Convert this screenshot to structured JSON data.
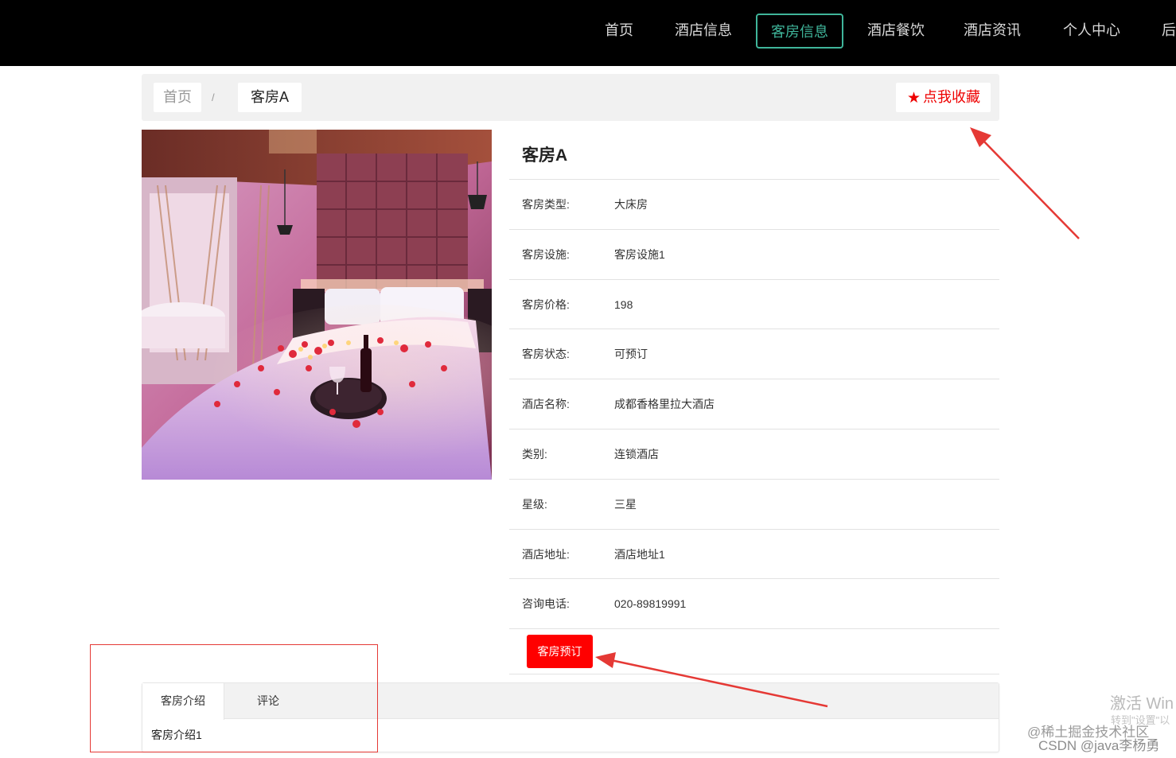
{
  "nav": {
    "items": [
      "首页",
      "酒店信息",
      "客房信息",
      "酒店餐饮",
      "酒店资讯",
      "个人中心",
      "后"
    ],
    "active_index": 2
  },
  "breadcrumb": {
    "home": "首页",
    "separator": "/",
    "current": "客房A"
  },
  "favorite": {
    "label": "点我收藏",
    "icon": "star-icon"
  },
  "room": {
    "image": "hotel-room-photo",
    "title": "客房A",
    "fields": [
      {
        "label": "客房类型:",
        "value": "大床房"
      },
      {
        "label": "客房设施:",
        "value": "客房设施1"
      },
      {
        "label": "客房价格:",
        "value": "198"
      },
      {
        "label": "客房状态:",
        "value": "可预订"
      },
      {
        "label": "酒店名称:",
        "value": "成都香格里拉大酒店"
      },
      {
        "label": "类别:",
        "value": "连锁酒店"
      },
      {
        "label": "星级:",
        "value": "三星"
      },
      {
        "label": "酒店地址:",
        "value": "酒店地址1"
      },
      {
        "label": "咨询电话:",
        "value": "020-89819991"
      }
    ],
    "book_label": "客房预订"
  },
  "tabs": {
    "items": [
      "客房介绍",
      "评论"
    ],
    "active_index": 0,
    "content": "客房介绍1"
  },
  "colors": {
    "nav_bg": "#000000",
    "accent": "#3fb59a",
    "book_button": "#ff0000",
    "favorite_text": "#ee0000",
    "annotation": "#e53935"
  },
  "watermarks": {
    "windows_line1": "激活 Win",
    "windows_line2": "转到\"设置\"以",
    "site": "@稀土掘金技术社区",
    "csdn": "CSDN @java李杨勇"
  }
}
